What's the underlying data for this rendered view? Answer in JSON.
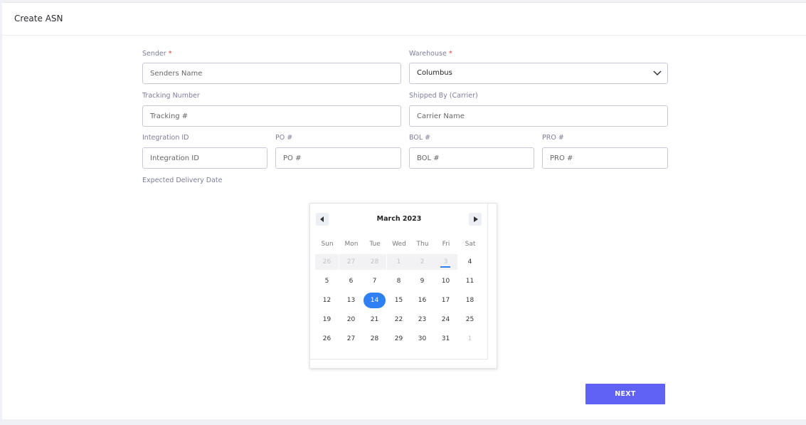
{
  "page": {
    "title": "Create ASN"
  },
  "form": {
    "sender": {
      "label": "Sender",
      "required_mark": "*",
      "placeholder": "Senders Name"
    },
    "warehouse": {
      "label": "Warehouse",
      "required_mark": "*",
      "value": "Columbus"
    },
    "tracking": {
      "label": "Tracking Number",
      "placeholder": "Tracking #"
    },
    "carrier": {
      "label": "Shipped By (Carrier)",
      "placeholder": "Carrier Name"
    },
    "integration": {
      "label": "Integration ID",
      "placeholder": "Integration ID"
    },
    "po": {
      "label": "PO #",
      "placeholder": "PO #"
    },
    "bol": {
      "label": "BOL #",
      "placeholder": "BOL #"
    },
    "pro": {
      "label": "PRO #",
      "placeholder": "PRO #"
    },
    "expected_delivery": {
      "label": "Expected Delivery Date"
    }
  },
  "datepicker": {
    "month_label": "March 2023",
    "weekdays": [
      "Sun",
      "Mon",
      "Tue",
      "Wed",
      "Thu",
      "Fri",
      "Sat"
    ],
    "weeks": [
      [
        "26",
        "27",
        "28",
        "1",
        "2",
        "3",
        "4"
      ],
      [
        "5",
        "6",
        "7",
        "8",
        "9",
        "10",
        "11"
      ],
      [
        "12",
        "13",
        "14",
        "15",
        "16",
        "17",
        "18"
      ],
      [
        "19",
        "20",
        "21",
        "22",
        "23",
        "24",
        "25"
      ],
      [
        "26",
        "27",
        "28",
        "29",
        "30",
        "31",
        "1"
      ]
    ],
    "selected_day": "14",
    "today_day": "3",
    "accent_color": "#2f80f2"
  },
  "actions": {
    "next_label": "NEXT",
    "next_color": "#6062f5"
  }
}
